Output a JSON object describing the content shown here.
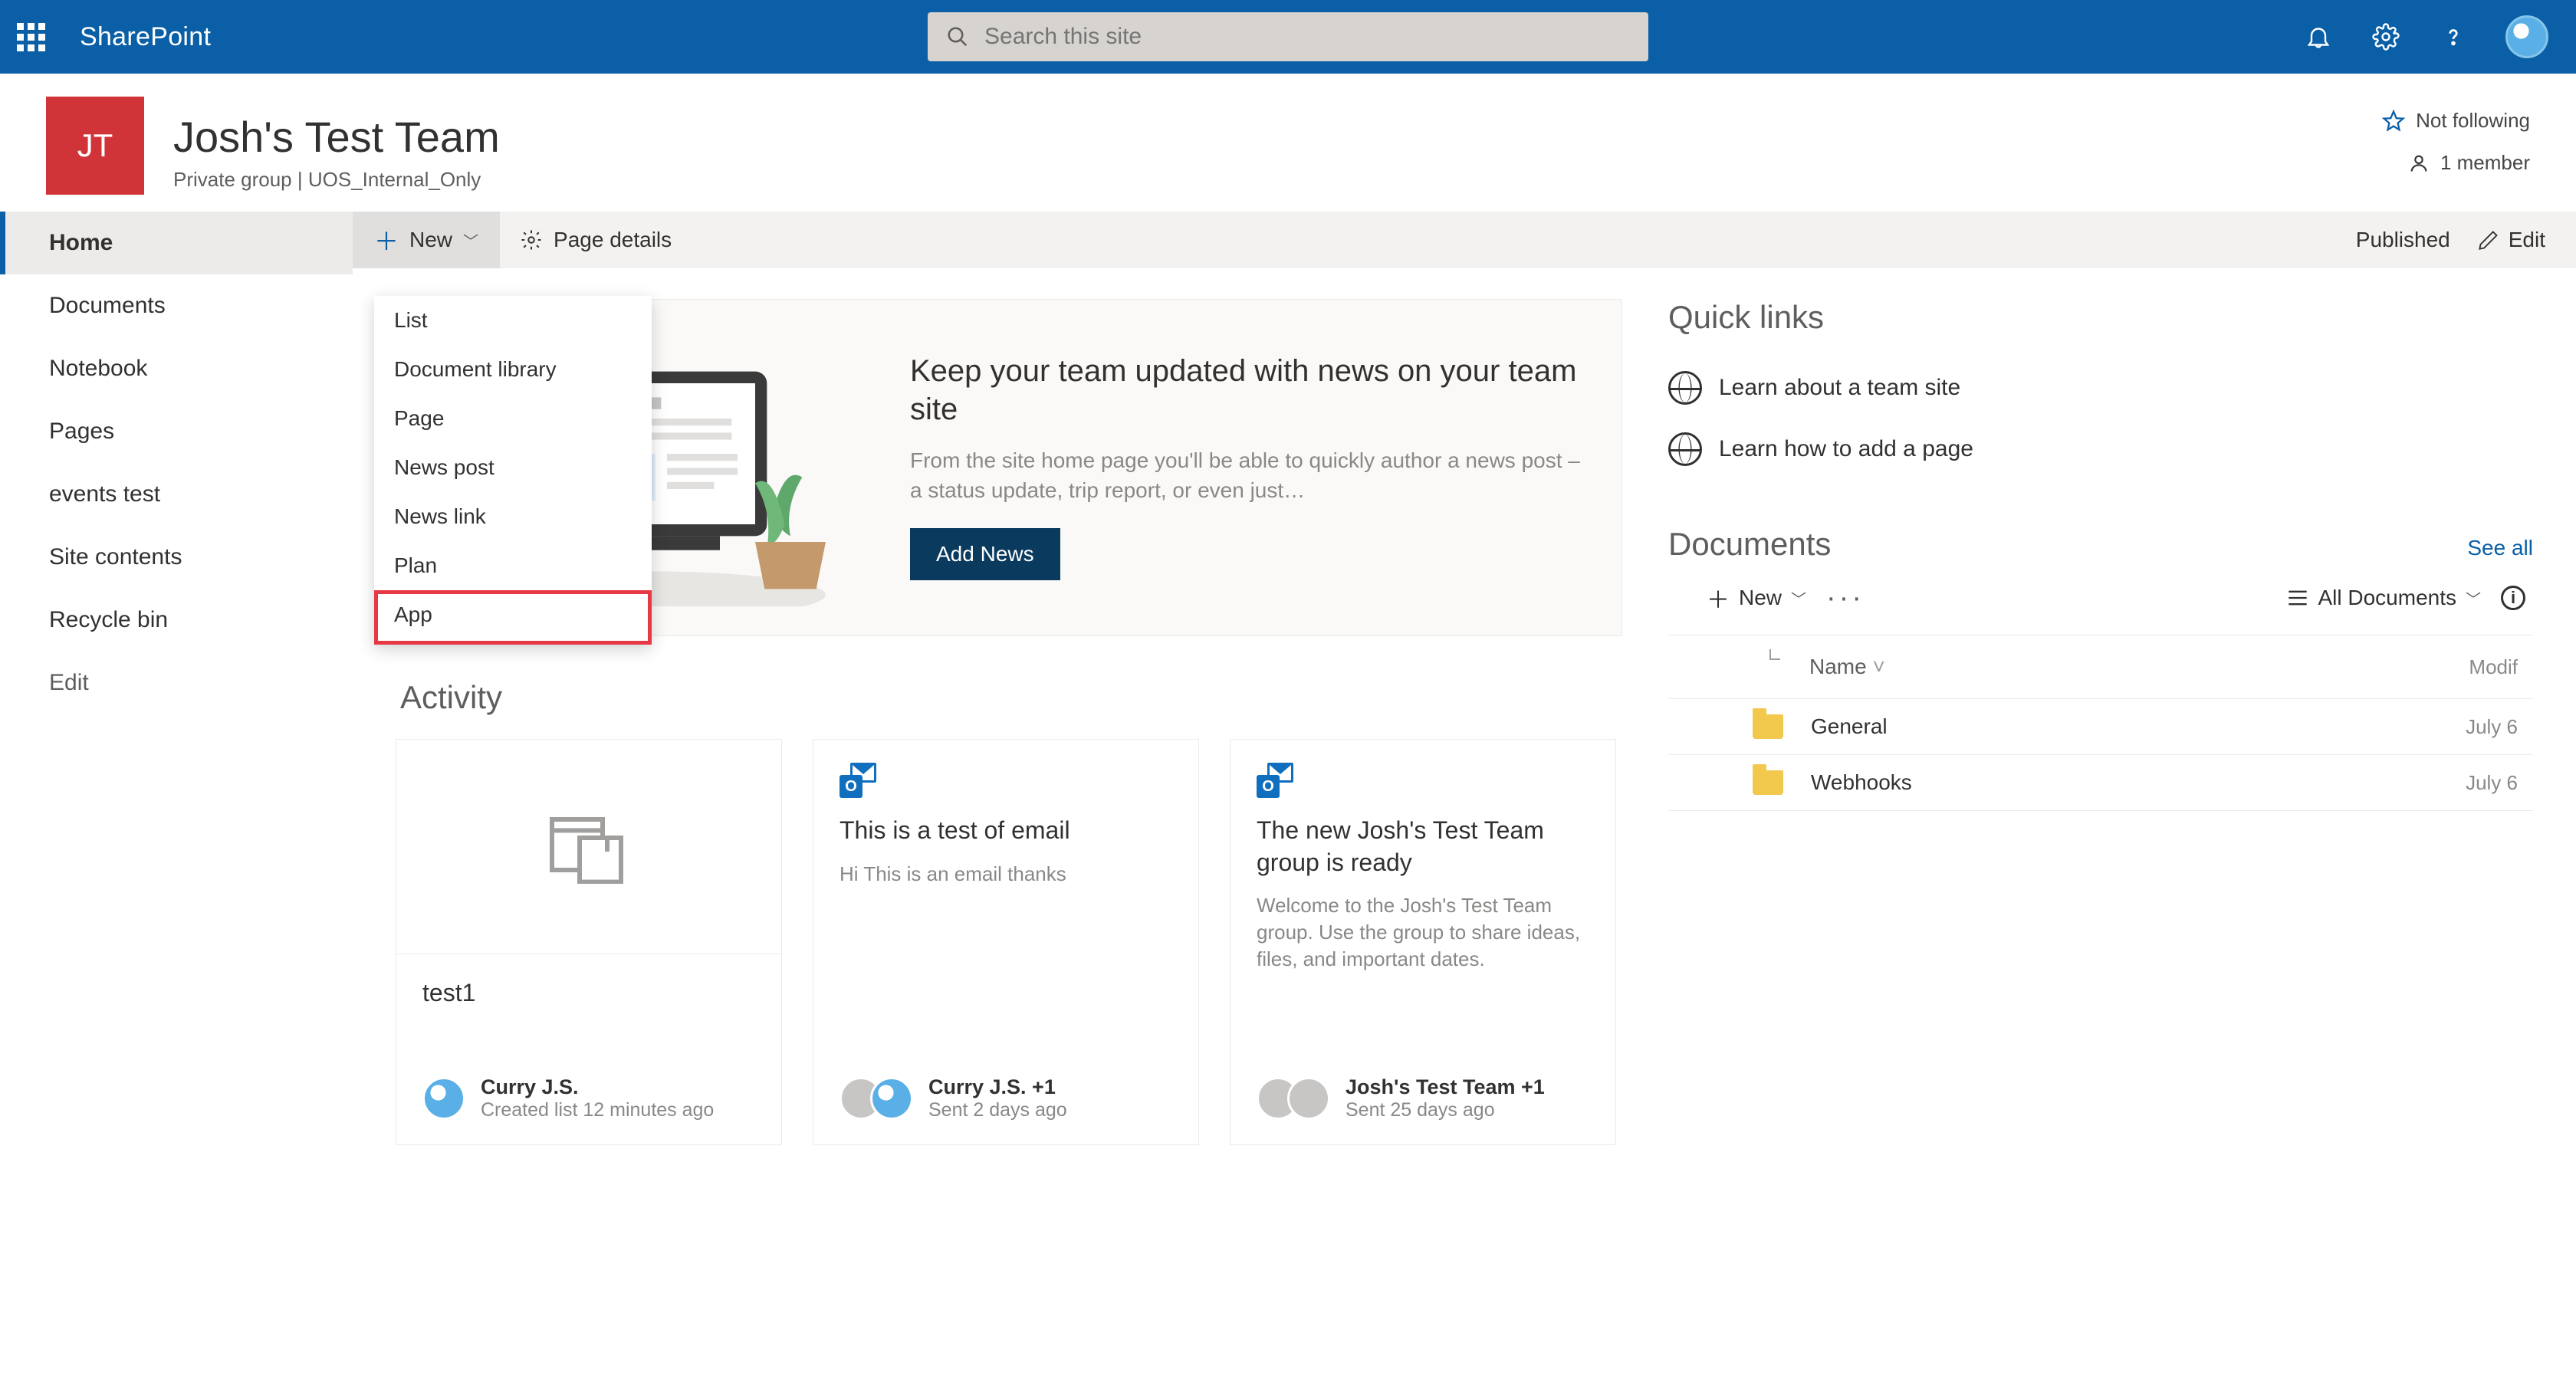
{
  "brand": "SharePoint",
  "search": {
    "placeholder": "Search this site"
  },
  "site": {
    "logo_initials": "JT",
    "title": "Josh's Test Team",
    "subtitle": "Private group | UOS_Internal_Only",
    "follow": "Not following",
    "members": "1 member"
  },
  "sidebar": {
    "items": [
      "Home",
      "Documents",
      "Notebook",
      "Pages",
      "events test",
      "Site contents",
      "Recycle bin",
      "Edit"
    ]
  },
  "cmdbar": {
    "new": "New",
    "page_details": "Page details",
    "published": "Published",
    "edit": "Edit"
  },
  "new_menu": [
    "List",
    "Document library",
    "Page",
    "News post",
    "News link",
    "Plan",
    "App"
  ],
  "news": {
    "heading": "Keep your team updated with news on your team site",
    "body": "From the site home page you'll be able to quickly author a news post – a status update, trip report, or even just…",
    "button": "Add News"
  },
  "activity": {
    "title": "Activity",
    "cards": [
      {
        "title": "test1",
        "type": "list",
        "author": "Curry J.S.",
        "sub": "Created list 12 minutes ago"
      },
      {
        "title": "This is a test of email",
        "type": "email",
        "desc": "Hi This is an email thanks",
        "author": "Curry J.S. +1",
        "sub": "Sent 2 days ago"
      },
      {
        "title": "The new Josh's Test Team group is ready",
        "type": "email",
        "desc": "Welcome to the Josh's Test Team group. Use the group to share ideas, files, and important dates.",
        "author": "Josh's Test Team +1",
        "sub": "Sent 25 days ago"
      }
    ]
  },
  "quicklinks": {
    "title": "Quick links",
    "items": [
      "Learn about a team site",
      "Learn how to add a page"
    ]
  },
  "documents": {
    "title": "Documents",
    "see_all": "See all",
    "new": "New",
    "view": "All Documents",
    "cols": {
      "name": "Name",
      "modified": "Modif"
    },
    "rows": [
      {
        "name": "General",
        "modified": "July 6"
      },
      {
        "name": "Webhooks",
        "modified": "July 6"
      }
    ]
  }
}
